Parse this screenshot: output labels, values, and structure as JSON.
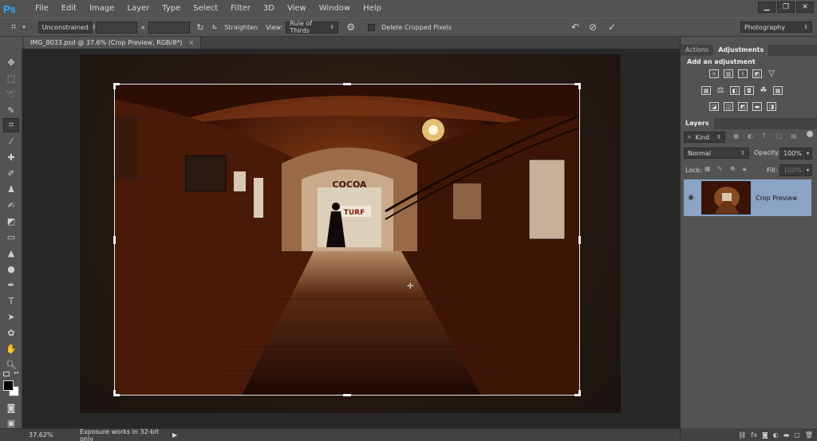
{
  "app": {
    "logo": "Ps"
  },
  "menu": [
    "File",
    "Edit",
    "Image",
    "Layer",
    "Type",
    "Select",
    "Filter",
    "3D",
    "View",
    "Window",
    "Help"
  ],
  "window_controls": {
    "minimize": "▁",
    "restore": "❐",
    "close": "✕"
  },
  "options": {
    "ratio_select": "Unconstrained",
    "ratio_separator": "×",
    "straighten_label": "Straighten",
    "view_label": "View:",
    "view_select": "Rule of Thirds",
    "delete_cropped_label": "Delete Cropped Pixels",
    "workspace_select": "Photography"
  },
  "document": {
    "tab_title": "IMG_8033.psd @ 37.6% (Crop Preview, RGB/8*)",
    "tab_close": "×"
  },
  "status": {
    "zoom": "37.62%",
    "message": "Exposure works in 32-bit only",
    "arrow": "▶"
  },
  "panels": {
    "adjust_tabs": [
      "Actions",
      "Adjustments"
    ],
    "adjust_title": "Add an adjustment",
    "layers_tabs": [
      "Layers"
    ],
    "kind_select": "Kind",
    "blend_select": "Normal",
    "opacity_label": "Opacity:",
    "opacity_value": "100%",
    "lock_label": "Lock:",
    "fill_label": "Fill:",
    "fill_value": "100%",
    "layer_name": "Crop Preview"
  },
  "photo_signs": {
    "sign_top": "COCOA",
    "sign_mid": "TURF"
  },
  "colors": {
    "accent": "#31a8ff",
    "layer_selected": "#8ba3c4",
    "canvas_bg": "#282828"
  }
}
